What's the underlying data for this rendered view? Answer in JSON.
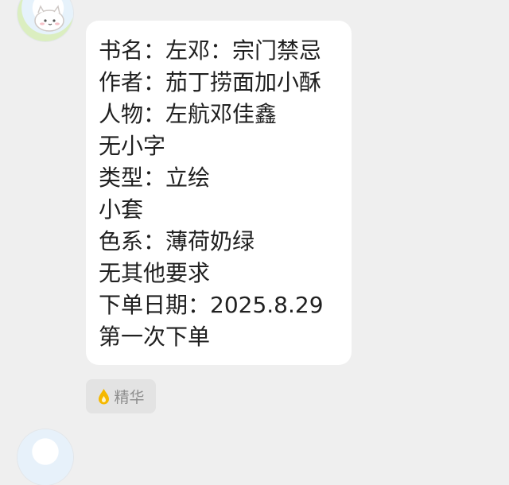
{
  "message": {
    "lines": [
      "书名：左邓：宗门禁忌",
      "作者：茄丁捞面加小酥",
      "人物：左航邓佳鑫",
      "无小字",
      "类型：立绘",
      "小套",
      "色系：薄荷奶绿",
      "无其他要求",
      "下单日期：2025.8.29",
      "第一次下单"
    ]
  },
  "badge": {
    "label": "精华",
    "icon": "flame-icon"
  },
  "colors": {
    "background": "#efefef",
    "bubble": "#ffffff",
    "badge_bg": "#e3e3e3",
    "badge_icon": "#f5b800"
  }
}
